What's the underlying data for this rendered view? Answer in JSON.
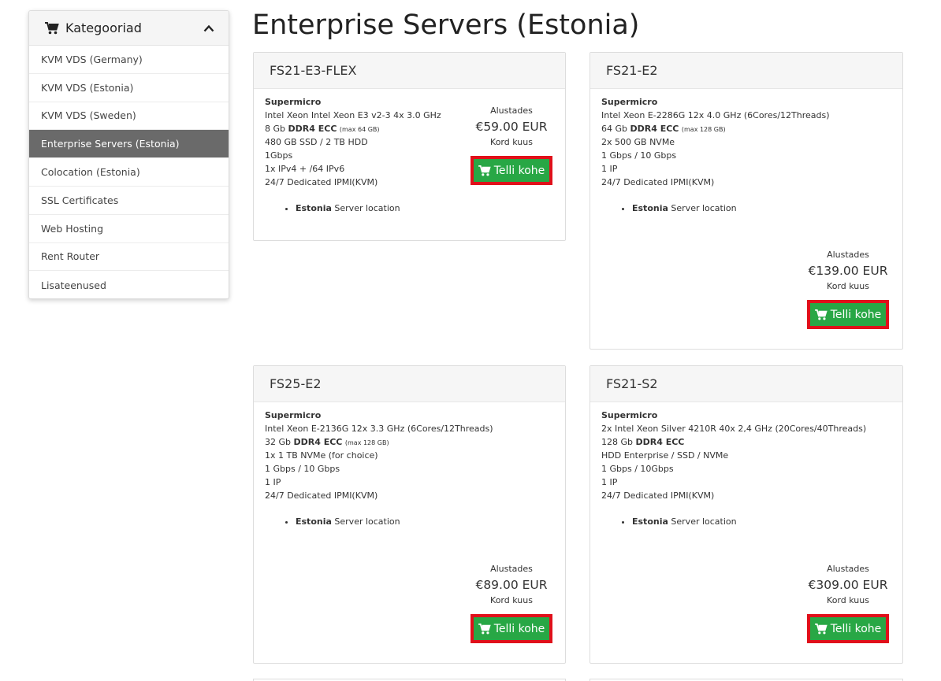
{
  "sidebar": {
    "title": "Kategooriad",
    "items": [
      {
        "label": "KVM VDS (Germany)",
        "active": false
      },
      {
        "label": "KVM VDS (Estonia)",
        "active": false
      },
      {
        "label": "KVM VDS (Sweden)",
        "active": false
      },
      {
        "label": "Enterprise Servers (Estonia)",
        "active": true
      },
      {
        "label": "Colocation (Estonia)",
        "active": false
      },
      {
        "label": "SSL Certificates",
        "active": false
      },
      {
        "label": "Web Hosting",
        "active": false
      },
      {
        "label": "Rent Router",
        "active": false
      },
      {
        "label": "Lisateenused",
        "active": false
      }
    ]
  },
  "page": {
    "title": "Enterprise Servers (Estonia)"
  },
  "products": [
    {
      "name": "FS21-E3-FLEX",
      "brand": "Supermicro",
      "cpu": "Intel Xeon Intel Xeon E3 v2-3 4x 3.0 GHz",
      "ram_size": "8 Gb",
      "ram_type": "DDR4 ECC",
      "ram_max": "(max 64 GB)",
      "storage": "480 GB SSD / 2 TB HDD",
      "network": "1Gbps",
      "ip": "1x IPv4 + /64 IPv6",
      "support": "24/7 Dedicated IPMI(KVM)",
      "location_bold": "Estonia",
      "location_text": "Server location",
      "price_from": "Alustades",
      "price": "€59.00 EUR",
      "period": "Kord kuus",
      "order_label": "Telli kohe"
    },
    {
      "name": "FS21-E2",
      "brand": "Supermicro",
      "cpu": "Intel Xeon E-2286G 12x 4.0 GHz (6Cores/12Threads)",
      "ram_size": "64 Gb",
      "ram_type": "DDR4 ECC",
      "ram_max": "(max 128 GB)",
      "storage": "2x 500 GB NVMe",
      "network": "1 Gbps / 10 Gbps",
      "ip": "1 IP",
      "support": "24/7 Dedicated IPMI(KVM)",
      "location_bold": "Estonia",
      "location_text": "Server location",
      "price_from": "Alustades",
      "price": "€139.00 EUR",
      "period": "Kord kuus",
      "order_label": "Telli kohe"
    },
    {
      "name": "FS25-E2",
      "brand": "Supermicro",
      "cpu": "Intel Xeon E-2136G 12x 3.3 GHz (6Cores/12Threads)",
      "ram_size": "32 Gb",
      "ram_type": "DDR4 ECC",
      "ram_max": "(max 128 GB)",
      "storage": "1x 1 TB NVMe (for choice)",
      "network": "1 Gbps / 10 Gbps",
      "ip": "1 IP",
      "support": "24/7 Dedicated IPMI(KVM)",
      "location_bold": "Estonia",
      "location_text": "Server location",
      "price_from": "Alustades",
      "price": "€89.00 EUR",
      "period": "Kord kuus",
      "order_label": "Telli kohe"
    },
    {
      "name": "FS21-S2",
      "brand": "Supermicro",
      "cpu": "2x Intel Xeon Silver 4210R 40x 2,4 GHz (20Cores/40Threads)",
      "ram_size": "128 Gb",
      "ram_type": "DDR4 ECC",
      "ram_max": "",
      "storage": "HDD Enterprise / SSD / NVMe",
      "network": "1 Gbps / 10Gbps",
      "ip": "1 IP",
      "support": "24/7 Dedicated IPMI(KVM)",
      "location_bold": "Estonia",
      "location_text": "Server location",
      "price_from": "Alustades",
      "price": "€309.00 EUR",
      "period": "Kord kuus",
      "order_label": "Telli kohe"
    }
  ],
  "colors": {
    "order_button_bg": "#28a745",
    "order_button_border": "#e0101a",
    "sidebar_active_bg": "#6a6a6a"
  }
}
